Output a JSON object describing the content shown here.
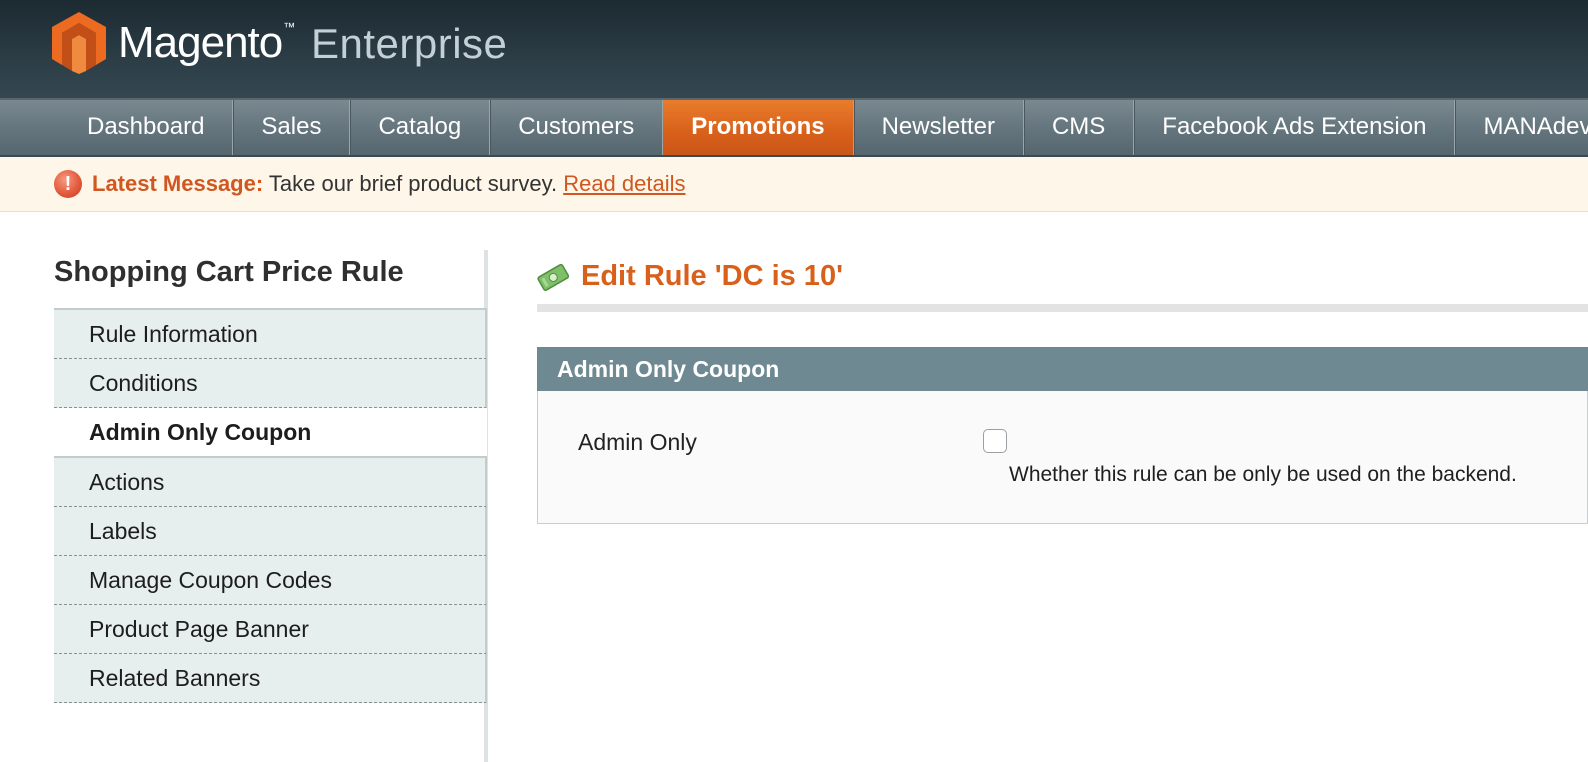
{
  "header": {
    "brand": "Magento",
    "brand_tm": "™",
    "edition": "Enterprise"
  },
  "nav": {
    "items": [
      {
        "label": "Dashboard"
      },
      {
        "label": "Sales"
      },
      {
        "label": "Catalog"
      },
      {
        "label": "Customers"
      },
      {
        "label": "Promotions",
        "active": true
      },
      {
        "label": "Newsletter"
      },
      {
        "label": "CMS"
      },
      {
        "label": "Facebook Ads Extension"
      },
      {
        "label": "MANAdev"
      }
    ]
  },
  "message": {
    "icon": "!",
    "label": "Latest Message:",
    "text": "Take our brief product survey.",
    "link": "Read details"
  },
  "sidebar": {
    "title": "Shopping Cart Price Rule",
    "tabs": [
      {
        "label": "Rule Information"
      },
      {
        "label": "Conditions"
      },
      {
        "label": "Admin Only Coupon",
        "active": true
      },
      {
        "label": "Actions"
      },
      {
        "label": "Labels"
      },
      {
        "label": "Manage Coupon Codes"
      },
      {
        "label": "Product Page Banner"
      },
      {
        "label": "Related Banners"
      }
    ]
  },
  "main": {
    "title": "Edit Rule 'DC is 10'",
    "fieldset_title": "Admin Only Coupon",
    "field_label": "Admin Only",
    "field_checked": false,
    "field_note": "Whether this rule can be only be used on the backend."
  },
  "colors": {
    "accent_orange": "#d8601a",
    "header_dark": "#2c3d46",
    "fieldset_header": "#6f8992",
    "tab_bg": "#e7eeee"
  }
}
